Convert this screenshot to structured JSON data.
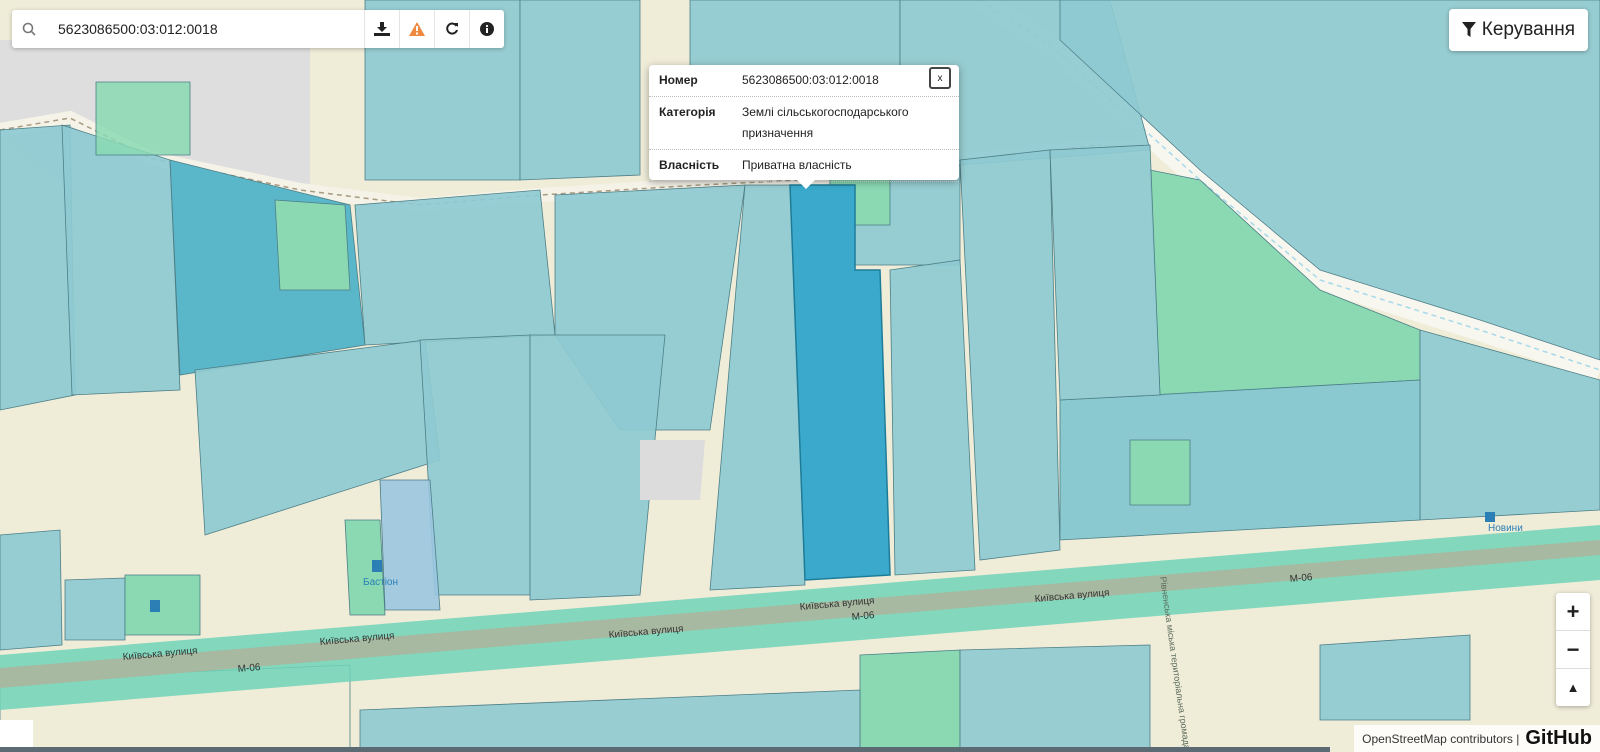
{
  "search": {
    "value": "5623086500:03:012:0018"
  },
  "controls": {
    "label": "Керування"
  },
  "popup": {
    "rows": [
      {
        "key": "Номер",
        "value": "5623086500:03:012:0018"
      },
      {
        "key": "Категорія",
        "value": "Землі сільськогосподарського призначення"
      },
      {
        "key": "Власність",
        "value": "Приватна власність"
      }
    ],
    "close": "x"
  },
  "map": {
    "street_name": "Київська вулиця",
    "road_ref": "М-06",
    "poi_bastion": "Бастіон",
    "poi_novyny": "Новини",
    "vertical_road": "Рівненська міська територіальна громада",
    "colors": {
      "parcel": "#8ecad1",
      "selected": "#3aa9cb",
      "green": "#8ad9b3",
      "road": "#a7b9a0",
      "road_band": "#6fd4b8",
      "background": "#efecd8"
    }
  },
  "zoom": {
    "in": "+",
    "out": "−",
    "north": "▲"
  },
  "attribution": {
    "text": "OpenStreetMap contributors |",
    "github": "GitHub"
  }
}
